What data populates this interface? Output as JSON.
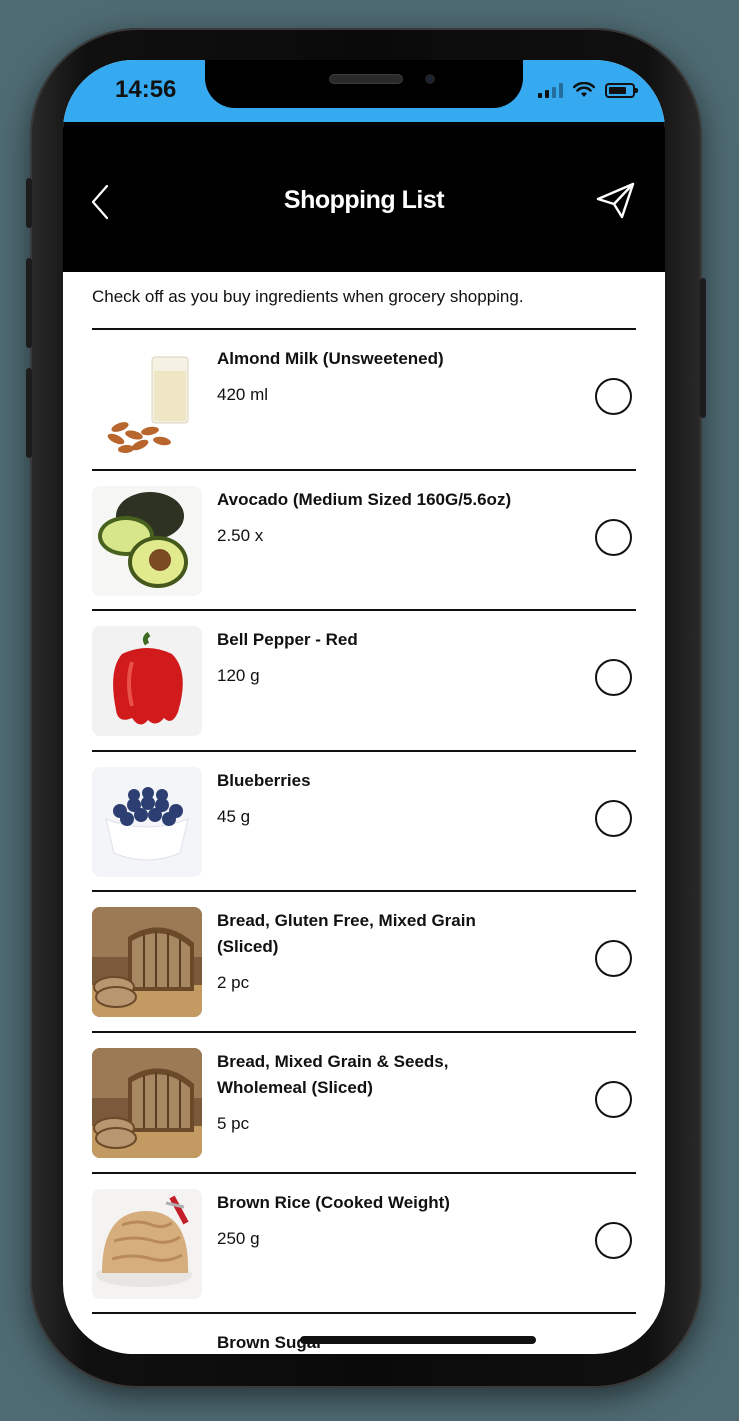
{
  "status_bar": {
    "time": "14:56",
    "accent_color": "#36aaf0"
  },
  "header": {
    "title": "Shopping List",
    "back_icon": "chevron-left-icon",
    "send_icon": "paper-plane-icon"
  },
  "instructions": "Check off as you buy ingredients when grocery shopping.",
  "items": [
    {
      "name": "Almond Milk (Unsweetened)",
      "quantity": "420 ml",
      "checked": false,
      "thumb": "almond-milk"
    },
    {
      "name": "Avocado (Medium Sized 160G/5.6oz)",
      "quantity": "2.50 x",
      "checked": false,
      "thumb": "avocado"
    },
    {
      "name": "Bell Pepper - Red",
      "quantity": "120 g",
      "checked": false,
      "thumb": "bell-pepper"
    },
    {
      "name": "Blueberries",
      "quantity": "45 g",
      "checked": false,
      "thumb": "blueberries"
    },
    {
      "name": "Bread, Gluten Free, Mixed Grain (Sliced)",
      "quantity": "2 pc",
      "checked": false,
      "thumb": "bread"
    },
    {
      "name": "Bread, Mixed Grain & Seeds, Wholemeal (Sliced)",
      "quantity": "5 pc",
      "checked": false,
      "thumb": "bread"
    },
    {
      "name": "Brown Rice (Cooked Weight)",
      "quantity": "250 g",
      "checked": false,
      "thumb": "brown-rice"
    },
    {
      "name": "Brown Sugar",
      "quantity": "",
      "checked": false,
      "thumb": ""
    }
  ]
}
